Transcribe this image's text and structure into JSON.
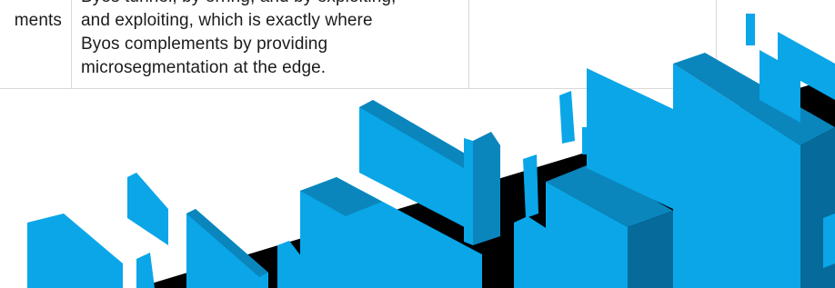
{
  "table": {
    "left_fragment_top": ",",
    "left_fragment": "ments",
    "middle_lines": [
      "Byos tunnel, by erring, and by exploiting,",
      "and exploiting, which is exactly where",
      "Byos complements by providing",
      "microsegmentation at the edge."
    ]
  },
  "colors": {
    "accent_blue": "#0aa6e8",
    "dark_blue": "#0a86bd",
    "deep_blue": "#066a9a",
    "black_band": "#000000"
  },
  "illustration": {
    "name": "isometric-blue-blocks-illustration"
  }
}
